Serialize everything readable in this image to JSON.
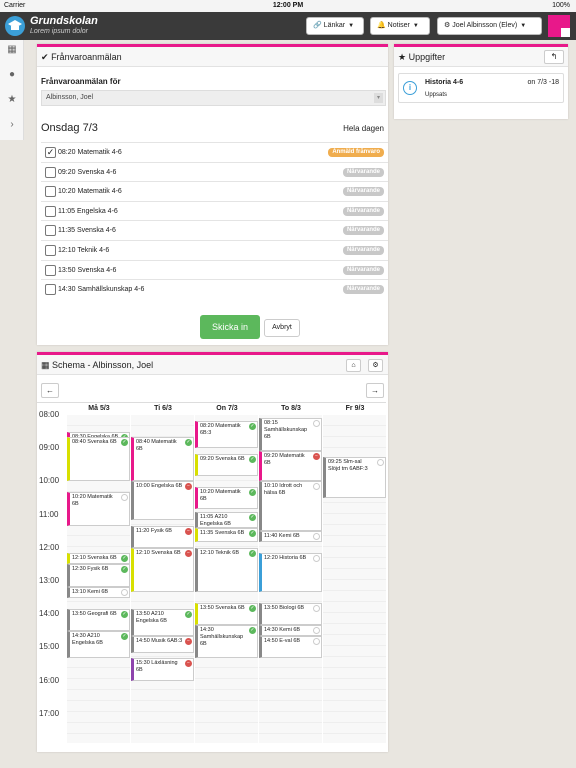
{
  "status_bar": {
    "carrier": "Carrier",
    "time": "12:00 PM",
    "battery": "100%"
  },
  "header": {
    "school": "Grundskolan",
    "subtitle": "Lorem ipsum dolor",
    "links_label": "Länkar",
    "notices_label": "Notiser",
    "user_label": "Joel Albinsson (Elev)"
  },
  "absence": {
    "title": "Frånvaroanmälan",
    "for_label": "Frånvaroanmälan för",
    "student": "Albinsson, Joel",
    "day": "Onsdag 7/3",
    "whole_day": "Hela dagen",
    "lessons": [
      {
        "text": "08:20 Matematik 4-6",
        "checked": true,
        "status": "Anmäld frånvaro",
        "status_color": "#f0ad4e"
      },
      {
        "text": "09:20 Svenska 4-6",
        "checked": false,
        "status": "Närvarande",
        "status_color": "#c8c8c8"
      },
      {
        "text": "10:20 Matematik 4-6",
        "checked": false,
        "status": "Närvarande",
        "status_color": "#c8c8c8"
      },
      {
        "text": "11:05 Engelska 4-6",
        "checked": false,
        "status": "Närvarande",
        "status_color": "#c8c8c8"
      },
      {
        "text": "11:35 Svenska 4-6",
        "checked": false,
        "status": "Närvarande",
        "status_color": "#c8c8c8"
      },
      {
        "text": "12:10 Teknik 4-6",
        "checked": false,
        "status": "Närvarande",
        "status_color": "#c8c8c8"
      },
      {
        "text": "13:50 Svenska 4-6",
        "checked": false,
        "status": "Närvarande",
        "status_color": "#c8c8c8"
      },
      {
        "text": "14:30 Samhällskunskap 4-6",
        "checked": false,
        "status": "Närvarande",
        "status_color": "#c8c8c8"
      }
    ],
    "submit": "Skicka in",
    "cancel": "Avbryt"
  },
  "tasks": {
    "title": "Uppgifter",
    "items": [
      {
        "title": "Historia 4-6",
        "sub": "Uppsats",
        "date": "on 7/3 -18"
      }
    ]
  },
  "schedule": {
    "title": "Schema - Albinsson, Joel",
    "days": [
      "Må 5/3",
      "Ti 6/3",
      "On 7/3",
      "To 8/3",
      "Fr 9/3"
    ],
    "hours": [
      "08:00",
      "09:00",
      "10:00",
      "11:00",
      "12:00",
      "13:00",
      "14:00",
      "15:00",
      "16:00",
      "17:00"
    ],
    "events": [
      {
        "day": 0,
        "start": "08:30",
        "end": "08:40",
        "text": "08:30 Engelska 6B",
        "color": "#e8188a",
        "mark": "ok"
      },
      {
        "day": 0,
        "start": "08:40",
        "end": "10:00",
        "text": "08:40 Svenska 6B",
        "color": "#d8e000",
        "mark": "ok"
      },
      {
        "day": 0,
        "start": "10:20",
        "end": "11:20",
        "text": "10:20 Matematik 6B",
        "color": "#e8188a",
        "mark": "em"
      },
      {
        "day": 0,
        "start": "12:10",
        "end": "12:30",
        "text": "12:10 Svenska 6B",
        "color": "#d8e000",
        "mark": "ok"
      },
      {
        "day": 0,
        "start": "12:30",
        "end": "13:10",
        "text": "12:30 Fysik 6B",
        "color": "#888888",
        "mark": "ok"
      },
      {
        "day": 0,
        "start": "13:10",
        "end": "13:30",
        "text": "13:10 Kemi 6B",
        "color": "#888888",
        "mark": "em"
      },
      {
        "day": 0,
        "start": "13:50",
        "end": "14:30",
        "text": "13:50 Geografi 6B",
        "color": "#888888",
        "mark": "ok"
      },
      {
        "day": 0,
        "start": "14:30",
        "end": "15:20",
        "text": "14:30 A210 Engelska 6B",
        "color": "#888888",
        "mark": "ok"
      },
      {
        "day": 1,
        "start": "08:40",
        "end": "10:00",
        "text": "08:40 Matematik 6B",
        "color": "#e8188a",
        "mark": "ok"
      },
      {
        "day": 1,
        "start": "10:00",
        "end": "11:10",
        "text": "10:00 Engelska 6B",
        "color": "#888888",
        "mark": "no"
      },
      {
        "day": 1,
        "start": "11:20",
        "end": "12:00",
        "text": "11:20 Fysik 6B",
        "color": "#888888",
        "mark": "no"
      },
      {
        "day": 1,
        "start": "12:00",
        "end": "13:20",
        "text": "12:10 Svenska 6B",
        "color": "#d8e000",
        "mark": "no"
      },
      {
        "day": 1,
        "start": "13:50",
        "end": "14:40",
        "text": "13:50 A210 Engelska 6B",
        "color": "#888888",
        "mark": "ok"
      },
      {
        "day": 1,
        "start": "14:40",
        "end": "15:10",
        "text": "14:50 Musik 6AB:3",
        "color": "#888888",
        "mark": "no"
      },
      {
        "day": 1,
        "start": "15:20",
        "end": "16:00",
        "text": "15:30 Läxläsning 6B",
        "color": "#8e44ad",
        "mark": "no"
      },
      {
        "day": 2,
        "start": "08:10",
        "end": "09:00",
        "text": "08:20 Matematik 6B:3",
        "color": "#e8188a",
        "mark": "ok"
      },
      {
        "day": 2,
        "start": "09:10",
        "end": "09:50",
        "text": "09:20 Svenska 6B",
        "color": "#d8e000",
        "mark": "ok"
      },
      {
        "day": 2,
        "start": "10:10",
        "end": "10:50",
        "text": "10:20 Matematik 6B",
        "color": "#e8188a",
        "mark": "ok"
      },
      {
        "day": 2,
        "start": "10:55",
        "end": "11:25",
        "text": "11:05 A210 Engelska 6B",
        "color": "#888888",
        "mark": "ok"
      },
      {
        "day": 2,
        "start": "11:25",
        "end": "11:50",
        "text": "11:35 Svenska 6B",
        "color": "#d8e000",
        "mark": "ok"
      },
      {
        "day": 2,
        "start": "12:00",
        "end": "13:20",
        "text": "12:10 Teknik 6B",
        "color": "#888888",
        "mark": "ok"
      },
      {
        "day": 2,
        "start": "13:40",
        "end": "14:20",
        "text": "13:50 Svenska 6B",
        "color": "#d8e000",
        "mark": "ok"
      },
      {
        "day": 2,
        "start": "14:20",
        "end": "15:20",
        "text": "14:30 Samhällskunskap 6B",
        "color": "#888888",
        "mark": "ok"
      },
      {
        "day": 3,
        "start": "08:05",
        "end": "09:05",
        "text": "08:15 Samhällskunskap 6B",
        "color": "#888888",
        "mark": "em"
      },
      {
        "day": 3,
        "start": "09:05",
        "end": "10:00",
        "text": "09:20 Matematik 6B",
        "color": "#e8188a",
        "mark": "no"
      },
      {
        "day": 3,
        "start": "10:00",
        "end": "11:30",
        "text": "10:10 Idrott och hälsa 6B",
        "color": "#888888",
        "mark": "em"
      },
      {
        "day": 3,
        "start": "11:30",
        "end": "11:50",
        "text": "11:40 Kemi 6B",
        "color": "#888888",
        "mark": "em"
      },
      {
        "day": 3,
        "start": "12:10",
        "end": "13:20",
        "text": "12:20 Historia 6B",
        "color": "#3b9fd8",
        "mark": "em"
      },
      {
        "day": 3,
        "start": "13:40",
        "end": "14:20",
        "text": "13:50 Biologi 6B",
        "color": "#888888",
        "mark": "em"
      },
      {
        "day": 3,
        "start": "14:20",
        "end": "14:40",
        "text": "14:30 Kemi 6B",
        "color": "#888888",
        "mark": "em"
      },
      {
        "day": 3,
        "start": "14:40",
        "end": "15:20",
        "text": "14:50 E-val 6B",
        "color": "#888888",
        "mark": "em"
      },
      {
        "day": 4,
        "start": "09:15",
        "end": "10:30",
        "text": "09:25 Slm-sal Slöjd tm 6ABF:3",
        "color": "#888888",
        "mark": "em"
      }
    ]
  }
}
